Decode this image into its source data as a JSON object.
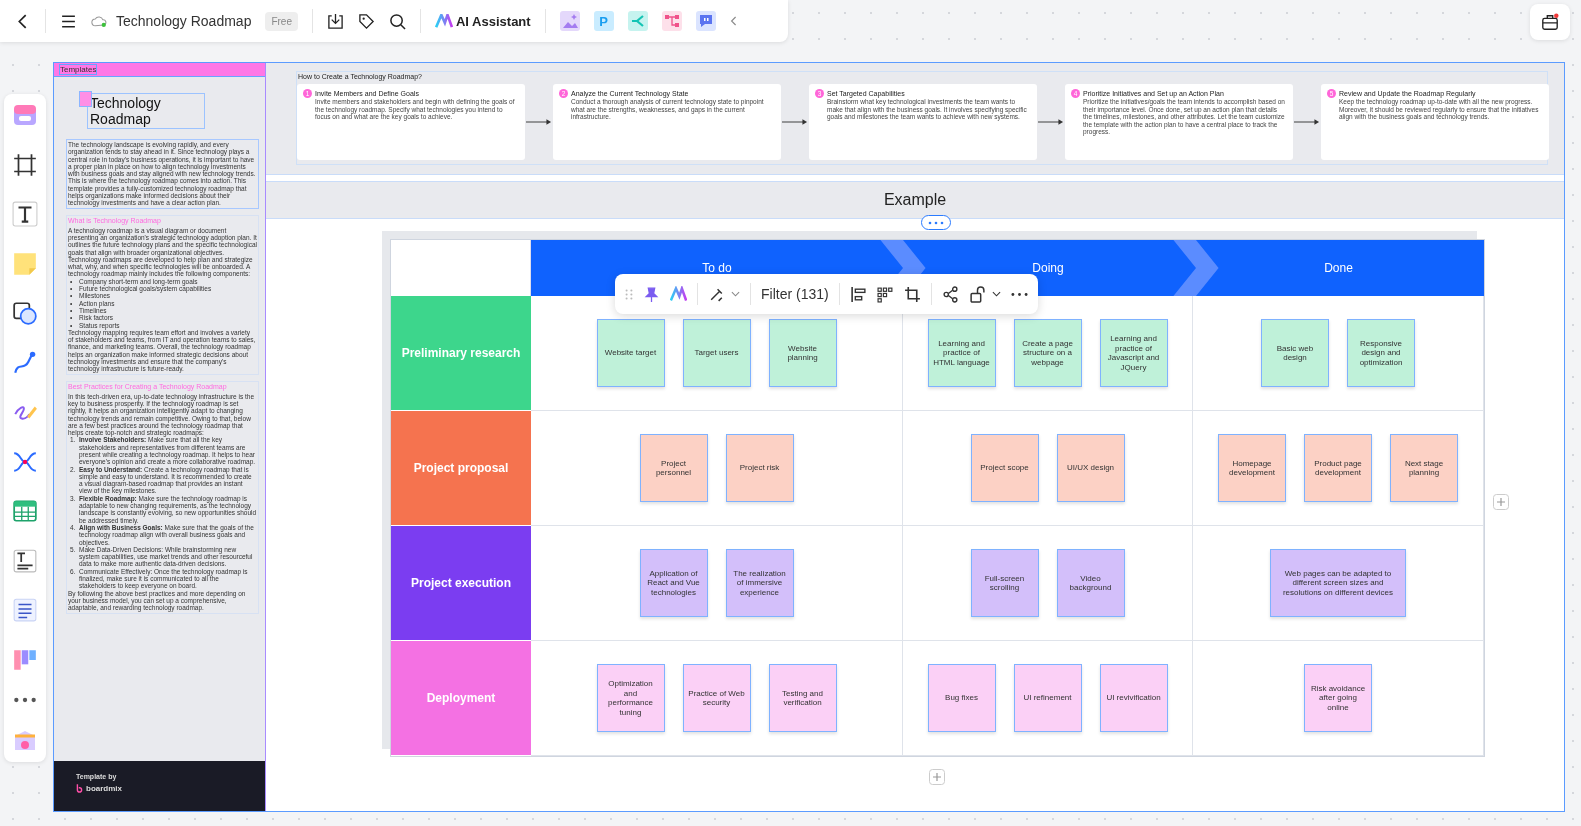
{
  "toolbar": {
    "title": "Technology Roadmap",
    "badge": "Free",
    "ai_label": "AI Assistant",
    "app_letter": "P"
  },
  "template_panel": {
    "tab": "Templates",
    "title": "Technology Roadmap",
    "intro": "The technology landscape is evolving rapidly, and every organization tends to stay ahead in it. Since technology plays a central role in today's business operations, it is important to have a proper plan in place on how to align technology investments with business goals and stay aligned with new technology trends. This is where the technology roadmap comes into action. This template provides a fully-customized technology roadmap that helps organizations make informed decisions about their technology investments and have a clear action plan.",
    "sections": [
      {
        "heading": "What is Technology Roadmap",
        "blocks": [
          {
            "kind": "p",
            "text": "A technology roadmap is a visual diagram or document presenting an organization's strategic technology adoption plan. It outlines the future technology plans and the specific technological goals that align with broader organizational objectives."
          },
          {
            "kind": "p",
            "text": "Technology roadmaps are developed to help plan and strategize what, why, and when specific technologies will be onboarded. A technology roadmap mainly includes the following components:"
          },
          {
            "kind": "list",
            "items": [
              {
                "marker": "•",
                "text": "Company short-term and long-term goals"
              },
              {
                "marker": "•",
                "text": "Future technological goals/system capabilities"
              },
              {
                "marker": "•",
                "text": "Milestones"
              },
              {
                "marker": "•",
                "text": "Action plans"
              },
              {
                "marker": "•",
                "text": "Timelines"
              },
              {
                "marker": "•",
                "text": "Risk factors"
              },
              {
                "marker": "•",
                "text": "Status reports"
              }
            ]
          },
          {
            "kind": "p",
            "text": "Technology mapping requires team effort and involves a variety of stakeholders and teams, from IT and operation teams to sales, finance, and marketing teams. Overall, the technology roadmap helps an organization make informed strategic decisions about technology investments and ensure that the company's technology infrastructure is future-ready."
          }
        ]
      },
      {
        "heading": "Best Practices for Creating a Technology Roadmap",
        "blocks": [
          {
            "kind": "p",
            "text": "In this tech-driven era, up-to-date technology infrastructure is the key to business prosperity. If the technology roadmap is set rightly, it helps an organization intelligently adapt to changing technology trends and remain competitive. Owing to that, below are a few best practices around the technology roadmap that helps create top-notch and strategic roadmaps:"
          },
          {
            "kind": "list",
            "items": [
              {
                "marker": "1.",
                "text": "**Involve Stakeholders:** Make sure that all the key stakeholders and representatives from different teams are present while creating a technology roadmap. It helps to hear everyone's opinion and create a more collaborative roadmap."
              },
              {
                "marker": "2.",
                "text": "**Easy to Understand:** Create a technology roadmap that is simple and easy to understand. It is recommended to create a visual diagram-based roadmap that provides an instant view of the key milestones."
              },
              {
                "marker": "3.",
                "text": "**Flexible Roadmap:** Make sure the technology roadmap is adaptable to new changing requirements, as the technology landscape is constantly evolving, so new opportunities should be addressed timely."
              },
              {
                "marker": "4.",
                "text": "**Align with Business Goals:** Make sure that the goals of the technology roadmap align with overall business goals and objectives."
              },
              {
                "marker": "5.",
                "text": "Make Data-Driven Decisions: While brainstorming new system capabilities, use market trends and other resourceful data to make more authentic data-driven decisions."
              },
              {
                "marker": "6.",
                "text": "Communicate Effectively: Once the technology roadmap is finalized, make sure it is communicated to all the stakeholders to keep everyone on board."
              }
            ]
          },
          {
            "kind": "p",
            "text": "By following the above best practices and more depending on your business model, you can set up a comprehensive, adaptable, and rewarding technology roadmap."
          }
        ]
      }
    ],
    "footer_label": "Template by",
    "brand": "boardmix"
  },
  "steps_panel": {
    "title": "How to Create a Technology Roadmap?",
    "steps": [
      {
        "number": "1",
        "title": "Invite Members and Define Goals",
        "text": "Invite members and stakeholders and begin with defining the goals of the technology roadmap. Specify what technologies you intend to focus on and what are the key goals to achieve."
      },
      {
        "number": "2",
        "title": "Analyze the Current Technology State",
        "text": "Conduct a thorough analysis of current technology state to pinpoint what are the strengths, weaknesses, and gaps in the current infrastructure."
      },
      {
        "number": "3",
        "title": "Set Targeted Capabilities",
        "text": "Brainstorm what key technological investments the team wants to make that align with the business goals. It involves specifying specific goals and milestones the team wants to achieve with new systems."
      },
      {
        "number": "4",
        "title": "Prioritize Initiatives and Set up an Action Plan",
        "text": "Prioritize the initiatives/goals the team intends to accomplish based on their importance level. Once done, set up an action plan that details the timelines, milestones, and other attributes. Let the team customize the template with the action plan to have a central place to track the progress."
      },
      {
        "number": "5",
        "title": "Review and Update the Roadmap Regularly",
        "text": "Keep the technology roadmap up-to-date with all the new progress. Moreover, it should be reviewed regularly to ensure that the initiatives align with the business goals and technology trends."
      }
    ]
  },
  "example": {
    "title": "Example"
  },
  "board": {
    "columns": [
      "To do",
      "Doing",
      "Done"
    ],
    "rows": [
      {
        "label": "Preliminary research",
        "color": "#3dd68c",
        "cells": [
          [
            "Website target",
            "Target users",
            "Website planning"
          ],
          [
            "Learning and practice of HTML language",
            "Create a page structure on a webpage",
            "Learning and practice of Javascript and JQuery"
          ],
          [
            "Basic web design",
            "Responsive design and optimization"
          ]
        ]
      },
      {
        "label": "Project proposal",
        "color": "#f5734f",
        "cells": [
          [
            "Project personnel",
            "Project risk"
          ],
          [
            "Project scope",
            "UI/UX design"
          ],
          [
            "Homepage development",
            "Product page development",
            "Next stage planning"
          ]
        ]
      },
      {
        "label": "Project execution",
        "color": "#7b3df1",
        "cells": [
          [
            "Application of React and Vue technologies",
            "The realization of immersive experience"
          ],
          [
            "Full-screen scrolling",
            "Video background"
          ],
          [
            "Web pages can be adapted to different screen sizes and resolutions on different devices"
          ]
        ]
      },
      {
        "label": "Deployment",
        "color": "#f471e3",
        "cells": [
          [
            "Optimization and performance tuning",
            "Practice of Web security",
            "Testing and verification"
          ],
          [
            "Bug fixes",
            "UI refinement",
            "UI revivification"
          ],
          [
            "Risk avoidance after going online"
          ]
        ]
      }
    ]
  },
  "float_toolbar": {
    "filter": "Filter (131)"
  }
}
